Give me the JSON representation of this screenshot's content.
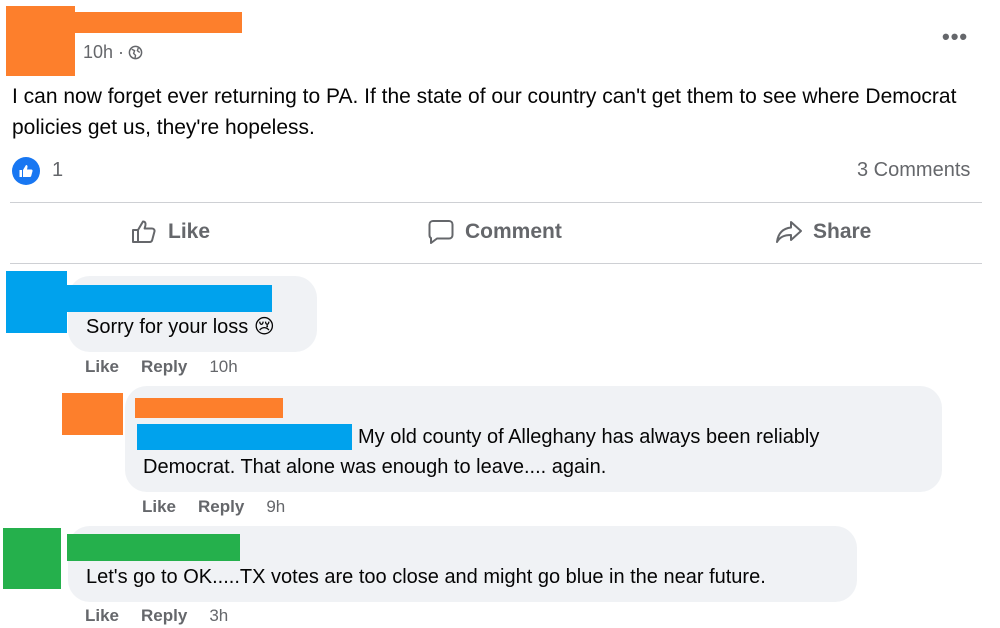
{
  "post": {
    "time": "10h ·",
    "more": "•••",
    "text": "I can now forget ever returning to PA. If the state of our country can't get them to see where Democrat policies get us, they're hopeless.",
    "reaction_count": "1",
    "comments_count": "3 Comments",
    "icons": {
      "privacy": "globe-icon",
      "more": "more-options-icon",
      "reaction": "like-reaction-icon"
    }
  },
  "actions": {
    "like": "Like",
    "comment": "Comment",
    "share": "Share"
  },
  "comments": [
    {
      "text": "Sorry for your loss",
      "emoji": "😢",
      "like": "Like",
      "reply": "Reply",
      "time": "10h"
    },
    {
      "text_line1": "My old county of Alleghany has always been reliably",
      "text_line2": "Democrat. That alone was enough to leave.... again.",
      "like": "Like",
      "reply": "Reply",
      "time": "9h"
    },
    {
      "text": "Let's go to OK.....TX votes are too close and might go blue in the near future.",
      "like": "Like",
      "reply": "Reply",
      "time": "3h"
    }
  ],
  "colors": {
    "redact_orange": "#fd7f2c",
    "redact_blue": "#00a2ed",
    "redact_green": "#25b04c",
    "accent": "#1877f2"
  }
}
